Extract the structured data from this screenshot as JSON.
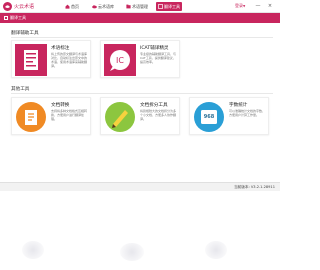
{
  "app": {
    "title": "火云术语"
  },
  "nav": [
    {
      "label": "首页",
      "icon": "home-icon"
    },
    {
      "label": "云术语库",
      "icon": "cloud-icon"
    },
    {
      "label": "术语管理",
      "icon": "folder-icon"
    },
    {
      "label": "翻译工具",
      "icon": "tools-icon",
      "active": true
    }
  ],
  "header": {
    "login": "登录",
    "dropdown_icon": "chevron-down-icon",
    "minimize": "—",
    "close": "×"
  },
  "subbar": {
    "label": "翻译工具"
  },
  "sections": [
    {
      "title": "翻译辅助工具",
      "cards": [
        {
          "name": "术语标注",
          "desc": "将上传的原文翻译与术语库对比，自动标注出原文中的术语，使用术语库来辅助翻译。",
          "icon": "term-tag-icon",
          "color": "#c8265e"
        },
        {
          "name": "ICAT辅译精灵",
          "desc": "专业级的辅助翻译工具，与CAT工具，提供翻译建议，提高效率。",
          "icon": "ic-bubble-icon",
          "color": "#c8265e"
        }
      ]
    },
    {
      "title": "其他工具",
      "cards": [
        {
          "name": "文档转换",
          "desc": "支持将多种文档格式互相转换，方便用户进行翻译处理。",
          "icon": "convert-icon",
          "color": "#f08a24"
        },
        {
          "name": "文档拆分工具",
          "desc": "将篇幅较大的文档拆分为多个小文档，方便多人协作翻译。",
          "icon": "split-pen-icon",
          "color": "#8cc63f"
        },
        {
          "name": "字数统计",
          "desc": "可以准确统计文档的字数，方便用户计算工作量。",
          "icon": "count-968-icon",
          "color": "#2a9fd6",
          "badge": "968"
        }
      ]
    }
  ],
  "footer": {
    "version": "当前版本: V3.2.1.28911"
  },
  "colors": {
    "accent": "#c8265e"
  }
}
